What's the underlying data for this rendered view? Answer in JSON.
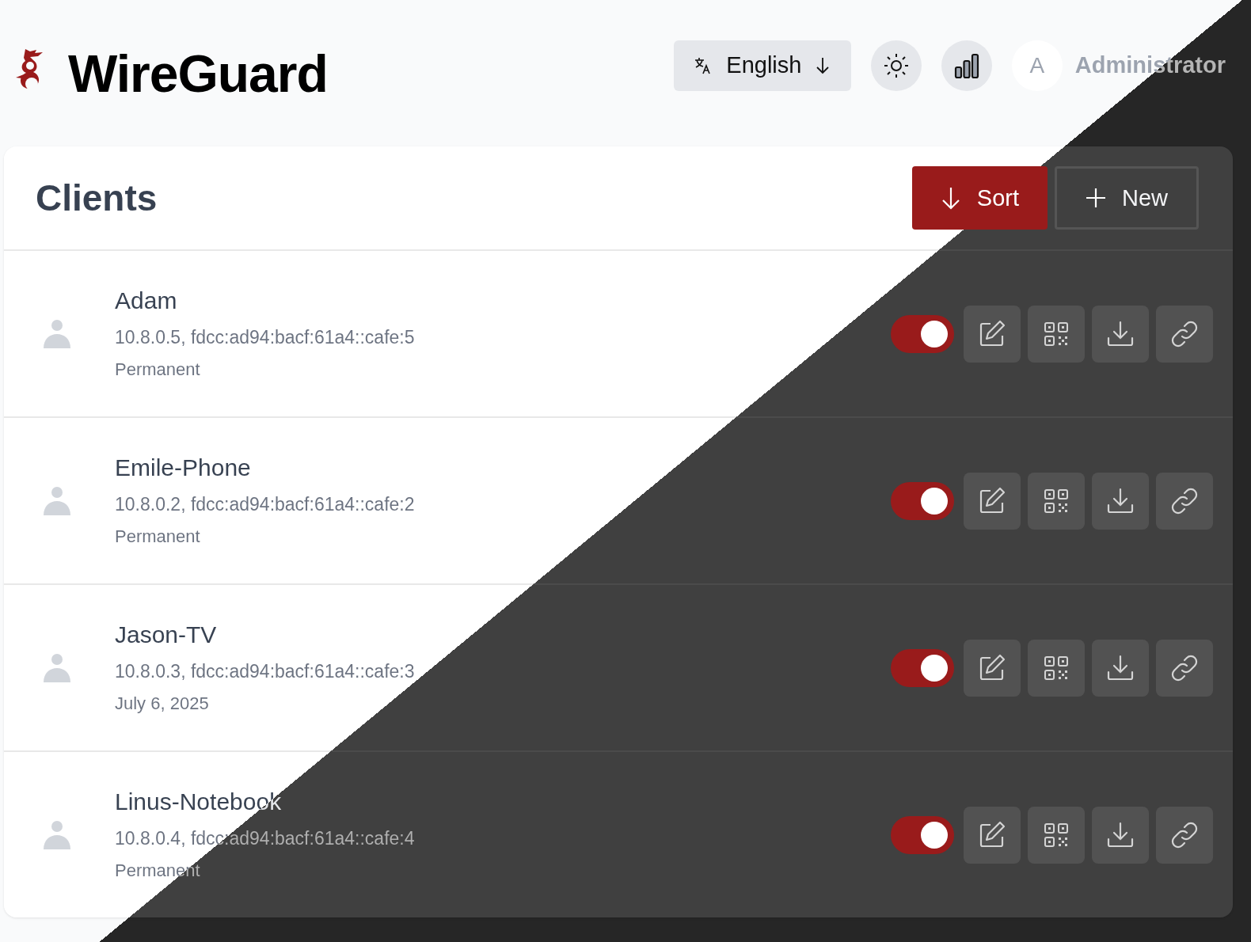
{
  "app": {
    "title": "WireGuard"
  },
  "header": {
    "language": "English",
    "user": {
      "initial": "A",
      "name": "Administrator"
    }
  },
  "clients_panel": {
    "title": "Clients",
    "buttons": [
      {
        "label": "Sort",
        "kind": "sort"
      },
      {
        "label": "New",
        "kind": "new"
      }
    ],
    "clients": [
      {
        "name": "Adam",
        "addresses": "10.8.0.5, fdcc:ad94:bacf:61a4::cafe:5",
        "expiry": "Permanent",
        "enabled": true
      },
      {
        "name": "Emile-Phone",
        "addresses": "10.8.0.2, fdcc:ad94:bacf:61a4::cafe:2",
        "expiry": "Permanent",
        "enabled": true
      },
      {
        "name": "Jason-TV",
        "addresses": "10.8.0.3, fdcc:ad94:bacf:61a4::cafe:3",
        "expiry": "July 6, 2025",
        "enabled": true
      },
      {
        "name": "Linus-Notebook",
        "addresses": "10.8.0.4, fdcc:ad94:bacf:61a4::cafe:4",
        "expiry": "Permanent",
        "enabled": true
      }
    ]
  }
}
